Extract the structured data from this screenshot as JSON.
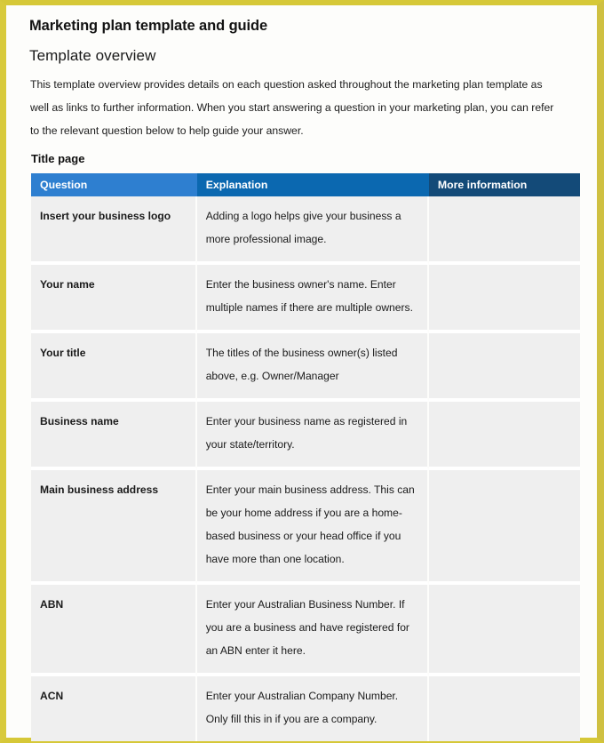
{
  "document": {
    "title": "Marketing plan template and guide",
    "section_title": "Template overview",
    "intro": "This template overview provides details on each question asked throughout the marketing plan template as well as links to further information. When you start answering a question in your marketing plan, you can refer to the relevant question below to help guide your answer.",
    "subsection_title": "Title page"
  },
  "colors": {
    "page_border": "#d6c838",
    "header_question": "#2e7fd0",
    "header_explanation": "#0b68b0",
    "header_more_information": "#134a78",
    "row_background": "#efefef",
    "page_background": "#fdfdfb"
  },
  "table": {
    "columns": [
      "Question",
      "Explanation",
      "More information"
    ],
    "rows": [
      {
        "question": "Insert your business logo",
        "explanation": "Adding a logo helps give your business a more professional image.",
        "more_information": ""
      },
      {
        "question": "Your name",
        "explanation": "Enter the business owner's name. Enter multiple names if there are multiple owners.",
        "more_information": ""
      },
      {
        "question": "Your title",
        "explanation": "The titles of the business owner(s) listed above, e.g. Owner/Manager",
        "more_information": ""
      },
      {
        "question": "Business name",
        "explanation": "Enter your business name as registered in your state/territory.",
        "more_information": ""
      },
      {
        "question": "Main business address",
        "explanation": "Enter your main business address. This can be your home address if you are a home-based business or your head office if you have more than one location.",
        "more_information": ""
      },
      {
        "question": "ABN",
        "explanation": "Enter your Australian Business Number. If you are a business and have registered for an ABN enter it here.",
        "more_information": ""
      },
      {
        "question": "ACN",
        "explanation": "Enter your Australian Company Number. Only fill this in if you are a company.",
        "more_information": ""
      }
    ]
  }
}
